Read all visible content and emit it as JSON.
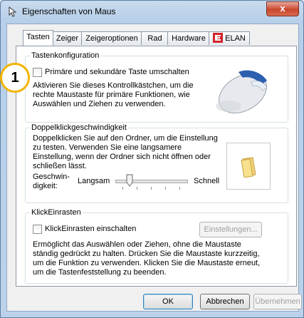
{
  "window": {
    "title": "Eigenschaften von Maus",
    "close_glyph": "x"
  },
  "tabs": [
    {
      "label": "Tasten",
      "active": true
    },
    {
      "label": "Zeiger",
      "active": false
    },
    {
      "label": "Zeigeroptionen",
      "active": false
    },
    {
      "label": "Rad",
      "active": false
    },
    {
      "label": "Hardware",
      "active": false
    },
    {
      "label": "ELAN",
      "active": false,
      "icon": "elan-icon"
    }
  ],
  "badge": {
    "number": "1"
  },
  "tastenkonfiguration": {
    "title": "Tastenkonfiguration",
    "checkbox_label": "Primäre und sekundäre Taste umschalten",
    "checked": false,
    "description": "Aktivieren Sie dieses Kontrollkästchen, um die rechte Maustaste für primäre Funktionen, wie Auswählen und Ziehen zu verwenden.",
    "image_icon": "mouse-icon"
  },
  "doppelklick": {
    "title": "Doppelklickgeschwindigkeit",
    "description": "Doppelklicken Sie auf den Ordner, um die Einstellung zu testen. Verwenden Sie eine langsamere Einstellung, wenn der Ordner sich nicht öffnen oder schließen lässt.",
    "speed_label": "Geschwin-\ndigkeit:",
    "slow_label": "Langsam",
    "fast_label": "Schnell",
    "slider_value_fraction": 0.2,
    "folder_icon": "folder-icon"
  },
  "klickeinrasten": {
    "title": "KlickEinrasten",
    "checkbox_label": "KlickEinrasten einschalten",
    "checked": false,
    "settings_button": "Einstellungen...",
    "description": "Ermöglicht das Auswählen oder Ziehen, ohne die Maustaste ständig gedrückt zu halten. Drücken Sie die Maustaste kurzzeitig, um die Funktion zu verwenden. Klicken Sie die Maustaste erneut, um die Tastenfeststellung zu beenden."
  },
  "buttons": {
    "ok": "OK",
    "cancel": "Abbrechen",
    "apply": "Übernehmen"
  },
  "colors": {
    "accent": "#3c7fb1",
    "badge_border": "#f3b500",
    "close_red": "#c9462c"
  }
}
